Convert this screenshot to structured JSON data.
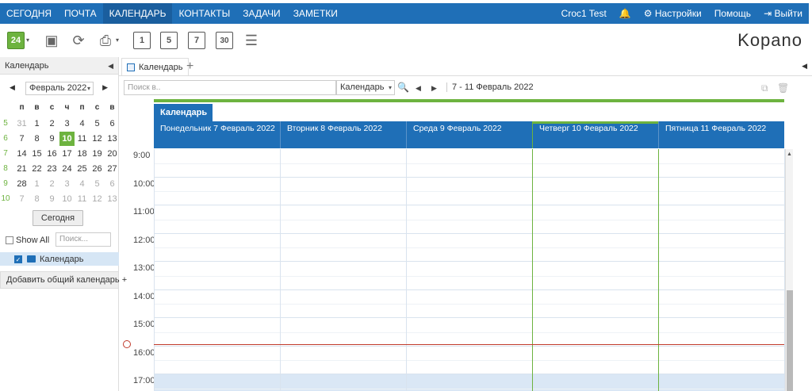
{
  "topnav": {
    "items": [
      "СЕГОДНЯ",
      "ПОЧТА",
      "КАЛЕНДАРЬ",
      "КОНТАКТЫ",
      "ЗАДАЧИ",
      "ЗАМЕТКИ"
    ],
    "active_index": 2,
    "user": "Croc1 Test",
    "settings": "Настройки",
    "help": "Помощь",
    "logout": "Выйти"
  },
  "toolbar": {
    "today_day": "24",
    "view_1": "1",
    "view_5": "5",
    "view_7": "7",
    "view_30": "30",
    "logo": "Kopano",
    "icons": [
      "new-appointment-icon",
      "address-book-icon",
      "refresh-icon",
      "print-icon",
      "list-view-icon"
    ]
  },
  "left": {
    "title": "Календарь",
    "month_select": "Февраль 2022",
    "weekday_headers": [
      "п",
      "в",
      "с",
      "ч",
      "п",
      "с",
      "в"
    ],
    "weeks": [
      {
        "num": "5",
        "days": [
          "31",
          "1",
          "2",
          "3",
          "4",
          "5",
          "6"
        ],
        "muted": [
          0
        ]
      },
      {
        "num": "6",
        "days": [
          "7",
          "8",
          "9",
          "10",
          "11",
          "12",
          "13"
        ],
        "muted": []
      },
      {
        "num": "7",
        "days": [
          "14",
          "15",
          "16",
          "17",
          "18",
          "19",
          "20"
        ],
        "muted": []
      },
      {
        "num": "8",
        "days": [
          "21",
          "22",
          "23",
          "24",
          "25",
          "26",
          "27"
        ],
        "muted": []
      },
      {
        "num": "9",
        "days": [
          "28",
          "1",
          "2",
          "3",
          "4",
          "5",
          "6"
        ],
        "muted": [
          1,
          2,
          3,
          4,
          5,
          6
        ]
      },
      {
        "num": "10",
        "days": [
          "7",
          "8",
          "9",
          "10",
          "11",
          "12",
          "13"
        ],
        "muted": [
          0,
          1,
          2,
          3,
          4,
          5,
          6
        ]
      }
    ],
    "selected": {
      "week": 1,
      "day": 3
    },
    "today_button": "Сегодня",
    "show_all": "Show All",
    "search_placeholder": "Поиск...",
    "calendar_item": "Календарь",
    "add_shared": "Добавить общий календарь +"
  },
  "tabs": {
    "active": "Календарь"
  },
  "searchbar": {
    "placeholder": "Поиск в..",
    "calendar_select": "Календарь",
    "date_range": "7 - 11 Февраль 2022"
  },
  "calendar": {
    "tab_label": "Календарь",
    "days": [
      "Понедельник 7 Февраль 2022",
      "Вторник 8 Февраль 2022",
      "Среда 9 Февраль 2022",
      "Четверг 10 Февраль 2022",
      "Пятница 11 Февраль 2022"
    ],
    "today_index": 3,
    "hours": [
      "9:00",
      "10:00",
      "11:00",
      "12:00",
      "13:00",
      "14:00",
      "15:00",
      "16:00",
      "17:00"
    ],
    "now_time": "16:00",
    "accent": "#1f6fb7",
    "today_color": "#6db33f"
  }
}
